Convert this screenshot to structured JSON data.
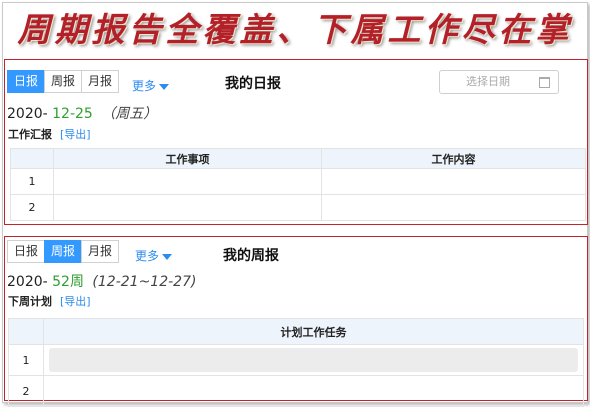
{
  "banner": {
    "text": "周期报告全覆盖、下属工作尽在掌握中"
  },
  "daily": {
    "tabs": [
      {
        "label": "日报",
        "active": true
      },
      {
        "label": "周报",
        "active": false
      },
      {
        "label": "月报",
        "active": false
      }
    ],
    "more_label": "更多",
    "title": "我的日报",
    "date_picker": {
      "placeholder": "选择日期"
    },
    "date": {
      "year": "2020-",
      "md": "12-25",
      "weekday": "（周五）"
    },
    "section": {
      "label": "工作汇报",
      "export_label": "[导出]"
    },
    "table": {
      "columns": [
        "",
        "工作事项",
        "工作内容"
      ],
      "rows": [
        {
          "index": "1"
        },
        {
          "index": "2"
        }
      ]
    }
  },
  "weekly": {
    "tabs": [
      {
        "label": "日报",
        "active": false
      },
      {
        "label": "周报",
        "active": true
      },
      {
        "label": "月报",
        "active": false
      }
    ],
    "more_label": "更多",
    "title": "我的周报",
    "date": {
      "year": "2020-",
      "week": "52周",
      "range": "(12-21~12-27)"
    },
    "section": {
      "label": "下周计划",
      "export_label": "[导出]"
    },
    "table": {
      "columns": [
        "",
        "计划工作任务"
      ],
      "rows": [
        {
          "index": "1"
        },
        {
          "index": "2"
        }
      ]
    }
  },
  "colors": {
    "banner": "#b3202a",
    "panel_border": "#c0242c",
    "tab_active": "#3399ff",
    "link": "#2d8cf0",
    "date_green": "#2ea02e",
    "table_header": "#eef4fb"
  },
  "icons": {
    "calendar": "calendar-icon",
    "caret": "chevron-down-icon"
  }
}
